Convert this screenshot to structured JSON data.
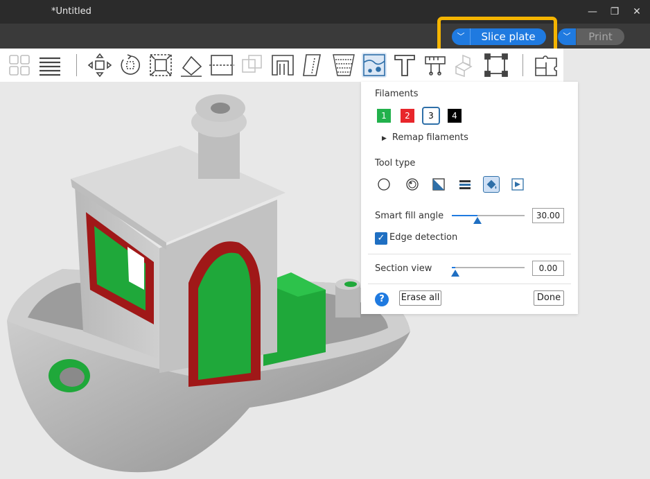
{
  "window": {
    "title": "*Untitled",
    "minimize": "—",
    "restore": "❐",
    "close": "✕"
  },
  "topbar": {
    "slice": {
      "arrow": "﹀",
      "label": "Slice plate"
    },
    "print": {
      "arrow": "﹀",
      "label": "Print"
    }
  },
  "toolbar": {
    "icons": [
      "arrange-icon",
      "layers-list-icon",
      "move-icon",
      "rotate-icon",
      "scale-icon",
      "place-on-face-icon",
      "cut-icon",
      "boolean-icon",
      "support-paint-icon",
      "seam-paint-icon",
      "fuzzy-skin-icon",
      "color-paint-icon",
      "text-icon",
      "measure-icon",
      "assembly-icon",
      "mesh-repair-icon",
      "split-parts-icon"
    ]
  },
  "panel": {
    "filaments_label": "Filaments",
    "filaments": [
      {
        "num": "1",
        "color": "#22b14c"
      },
      {
        "num": "2",
        "color": "#e8262b"
      },
      {
        "num": "3",
        "color": "#ffffff"
      },
      {
        "num": "4",
        "color": "#000000"
      }
    ],
    "remap_label": "Remap filaments",
    "tool_type_label": "Tool type",
    "smart_fill_label": "Smart fill angle",
    "smart_fill_value": "30.00",
    "smart_fill_fraction": 0.35,
    "edge_detection_label": "Edge detection",
    "edge_detection_checked": true,
    "section_view_label": "Section view",
    "section_view_value": "0.00",
    "section_view_fraction": 0.05,
    "help": "?",
    "erase_all": "Erase all",
    "done": "Done"
  },
  "colors": {
    "accent": "#1f7ae0",
    "highlight": "#f4b400"
  }
}
